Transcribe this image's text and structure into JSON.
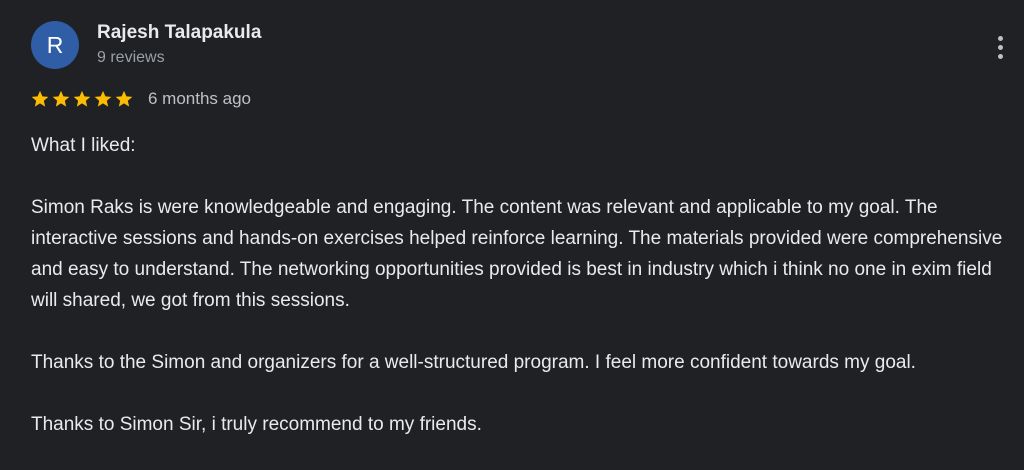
{
  "reviewer": {
    "initial": "R",
    "name": "Rajesh Talapakula",
    "review_count": "9 reviews",
    "avatar_color": "#2f5ea6"
  },
  "rating": {
    "stars": 5,
    "max_stars": 5,
    "star_color": "#fbbc04",
    "time_ago": "6 months ago"
  },
  "menu": {
    "icon": "more-vert-icon"
  },
  "review": {
    "paragraphs": [
      "What I liked:",
      "Simon Raks is were knowledgeable and engaging. The content was relevant and applicable to my goal. The interactive sessions and hands-on exercises helped reinforce learning. The materials provided were comprehensive and easy to understand. The networking opportunities provided is best in industry which i think no one in exim field will shared, we got from this sessions.",
      "Thanks to the Simon and organizers for a well-structured program. I feel more confident towards my goal.",
      "Thanks to Simon Sir, i truly recommend to my friends."
    ]
  }
}
